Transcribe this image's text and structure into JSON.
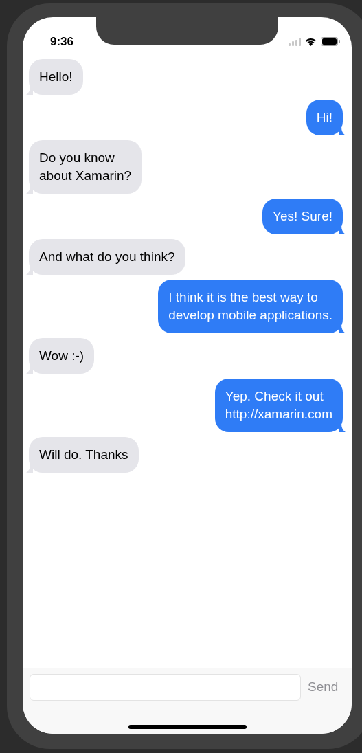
{
  "status_bar": {
    "time": "9:36"
  },
  "messages": [
    {
      "kind": "received",
      "text": "Hello!"
    },
    {
      "kind": "sent",
      "text": "Hi!"
    },
    {
      "kind": "received",
      "text": "Do you know\nabout Xamarin?"
    },
    {
      "kind": "sent",
      "text": "Yes! Sure!"
    },
    {
      "kind": "received",
      "text": "And what do you think?"
    },
    {
      "kind": "sent",
      "text": "I think it is the best way to\ndevelop mobile applications."
    },
    {
      "kind": "received",
      "text": "Wow :-)"
    },
    {
      "kind": "sent",
      "text": "Yep. Check it out\nhttp://xamarin.com"
    },
    {
      "kind": "received",
      "text": "Will do. Thanks"
    }
  ],
  "composer": {
    "send_label": "Send"
  }
}
